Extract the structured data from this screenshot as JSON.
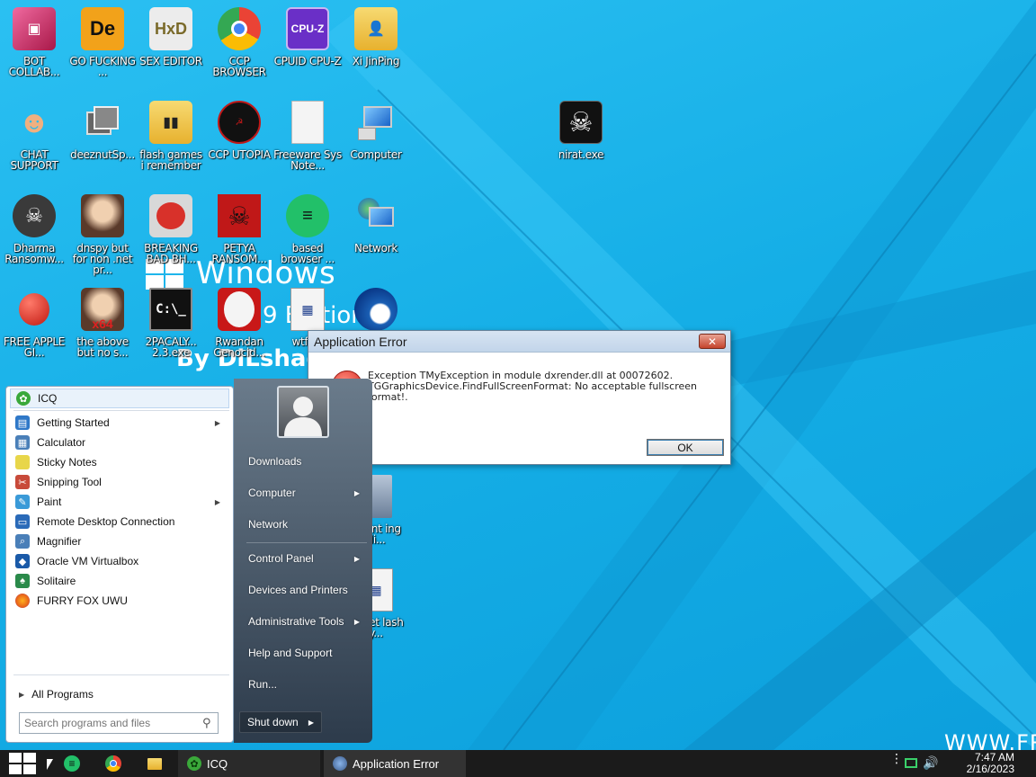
{
  "desktop": {
    "watermark": {
      "title": "Windows",
      "edition": "9 Edition",
      "author": "By DiLshad",
      "corner": "WWW.FR"
    },
    "icons": [
      {
        "label": "BOT COLLAB...",
        "icon": "monitor-pink-icon",
        "color": "#d0306a"
      },
      {
        "label": "GO FUCKING ...",
        "icon": "de-app-icon",
        "color": "#f2a21a"
      },
      {
        "label": "SEX EDITOR",
        "icon": "hxd-editor-icon",
        "color": "#e8e8e8"
      },
      {
        "label": "CCP BROWSER",
        "icon": "chromium-browser-icon",
        "color": "#2f8cf0"
      },
      {
        "label": "CPUID CPU-Z",
        "icon": "cpu-z-icon",
        "color": "#6a2fc7"
      },
      {
        "label": "Xi JinPing",
        "icon": "user-folder-icon",
        "color": "#f3c94a"
      },
      {
        "label": "CHAT SUPPORT",
        "icon": "doctor-icon",
        "color": "#f0b080"
      },
      {
        "label": "deeznutSp...",
        "icon": "windows-stack-icon",
        "color": "#555555"
      },
      {
        "label": "flash games i remember",
        "icon": "folder-icon",
        "color": "#f3c94a"
      },
      {
        "label": "CCP UTOPIA",
        "icon": "ccp-utopia-icon",
        "color": "#111111"
      },
      {
        "label": "Freeware Sys Note...",
        "icon": "document-icon",
        "color": "#f2f2f2"
      },
      {
        "label": "Computer",
        "icon": "computer-icon",
        "color": "#3a88d8"
      },
      {
        "label": "Dharma Ransomw...",
        "icon": "skull-helmet-icon",
        "color": "#3a3a3a"
      },
      {
        "label": "dnspy but for non .net pr...",
        "icon": "portrait-icon",
        "color": "#a87850"
      },
      {
        "label": "BREAKING BAD BH...",
        "icon": "angry-bird-icon",
        "color": "#d8312a"
      },
      {
        "label": "PETYA RANSOM...",
        "icon": "petya-skull-icon",
        "color": "#c01818"
      },
      {
        "label": "based browser ...",
        "icon": "chat-browser-icon",
        "color": "#22c069"
      },
      {
        "label": "Network",
        "icon": "network-icon",
        "color": "#3a88d8"
      },
      {
        "label": "FREE APPLE GI...",
        "icon": "apple-icon",
        "color": "#d52a1c"
      },
      {
        "label": "the above but no s...",
        "icon": "portrait-x64-icon",
        "color": "#a87850"
      },
      {
        "label": "2PACALY... 2.3.exe",
        "icon": "cmd-icon",
        "color": "#111111"
      },
      {
        "label": "Rwandan Genocid...",
        "icon": "meme-icon",
        "color": "#c81818"
      },
      {
        "label": "wtf i...",
        "icon": "exe-window-icon",
        "color": "#f2f2f2"
      },
      {
        "label": "",
        "icon": "blue-swirl-icon",
        "color": "#1a5fb4"
      },
      {
        "label": "nirat.exe",
        "icon": "skull-icon",
        "color": "#111111"
      },
      {
        "label": "is aint ing di...",
        "icon": "computer-tower-icon",
        "color": "#7a8ea8"
      },
      {
        "label": "forget lash y...",
        "icon": "exe-window-icon",
        "color": "#f2f2f2"
      }
    ]
  },
  "start_menu": {
    "programs": [
      {
        "label": "ICQ",
        "icon": "icq-flower-icon",
        "color": "#3aa83a",
        "submenu": false
      },
      {
        "label": "Getting Started",
        "icon": "getting-started-icon",
        "color": "#2f78c8",
        "submenu": true
      },
      {
        "label": "Calculator",
        "icon": "calculator-icon",
        "color": "#4a7fb8",
        "submenu": false
      },
      {
        "label": "Sticky Notes",
        "icon": "sticky-notes-icon",
        "color": "#e8d64a",
        "submenu": false
      },
      {
        "label": "Snipping Tool",
        "icon": "scissors-icon",
        "color": "#c84a3a",
        "submenu": false
      },
      {
        "label": "Paint",
        "icon": "paint-palette-icon",
        "color": "#3a9ad8",
        "submenu": true
      },
      {
        "label": "Remote Desktop Connection",
        "icon": "remote-desktop-icon",
        "color": "#2a6ab8",
        "submenu": false
      },
      {
        "label": "Magnifier",
        "icon": "magnifier-icon",
        "color": "#4a7fb8",
        "submenu": false
      },
      {
        "label": "Oracle VM Virtualbox",
        "icon": "virtualbox-icon",
        "color": "#1a5aa8",
        "submenu": false
      },
      {
        "label": "Solitaire",
        "icon": "solitaire-icon",
        "color": "#2a8a4a",
        "submenu": false
      },
      {
        "label": "FURRY FOX UWU",
        "icon": "firefox-icon",
        "color": "#e8651a",
        "submenu": false
      }
    ],
    "all_programs": "All Programs",
    "search_placeholder": "Search programs and files",
    "right_items": [
      {
        "label": "Downloads",
        "submenu": false
      },
      {
        "label": "Computer",
        "submenu": true
      },
      {
        "label": "Network",
        "submenu": false
      },
      {
        "label": "Control Panel",
        "submenu": true
      },
      {
        "label": "Devices and Printers",
        "submenu": false
      },
      {
        "label": "Administrative Tools",
        "submenu": true
      },
      {
        "label": "Help and Support",
        "submenu": false
      },
      {
        "label": "Run...",
        "submenu": false
      }
    ],
    "shutdown_label": "Shut down"
  },
  "dialog": {
    "title": "Application Error",
    "message_line1": "Exception TMyException in module dxrender.dll at 00072602.",
    "message_line2": "TGGraphicsDevice.FindFullScreenFormat: No acceptable fullscreen",
    "message_line3": "format!.",
    "ok_label": "OK"
  },
  "taskbar": {
    "tasks": [
      {
        "label": "ICQ",
        "icon": "icq-flower-icon"
      },
      {
        "label": "Application Error",
        "icon": "app-error-icon"
      }
    ],
    "clock_time": "7:47 AM",
    "clock_date": "2/16/2023"
  }
}
